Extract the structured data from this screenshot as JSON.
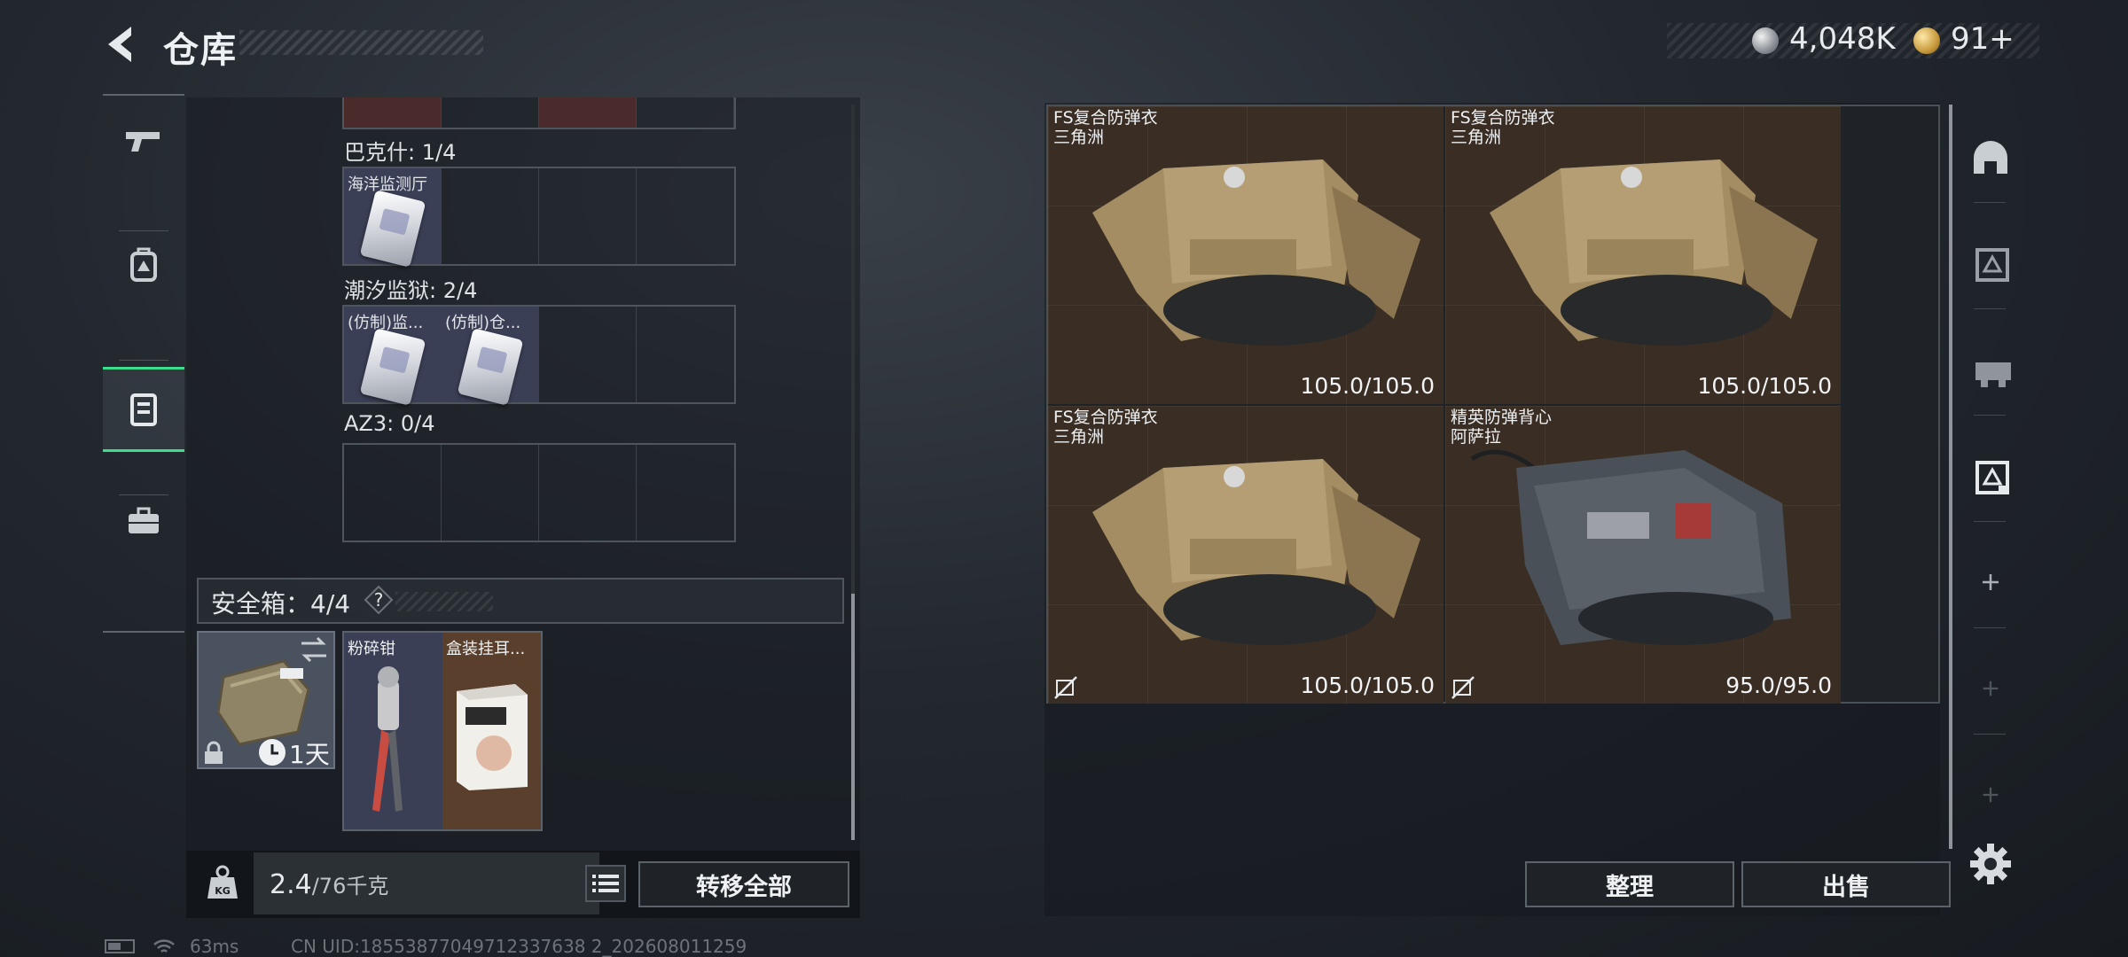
{
  "header": {
    "title": "仓库",
    "currency": {
      "silver": "4,048K",
      "gold": "91+"
    }
  },
  "storage": {
    "cases": [
      {
        "label": "巴克什: 1/4",
        "items": [
          "海洋监测厅"
        ]
      },
      {
        "label": "潮汐监狱: 2/4",
        "items": [
          "(仿制)监...",
          "(仿制)仓..."
        ]
      },
      {
        "label": "AZ3: 0/4",
        "items": []
      }
    ]
  },
  "safebox": {
    "label": "安全箱：4/4",
    "help": "?",
    "timer": "1天",
    "items": [
      "粉碎钳",
      "盒装挂耳..."
    ]
  },
  "weight": {
    "current": "2.4",
    "capacity": "/76千克"
  },
  "buttons": {
    "transfer_all": "转移全部",
    "sort": "整理",
    "sell": "出售"
  },
  "inventory": [
    {
      "name": "FS复合防弹衣",
      "map": "三角洲",
      "durability": "105.0/105.0"
    },
    {
      "name": "FS复合防弹衣",
      "map": "三角洲",
      "durability": "105.0/105.0"
    },
    {
      "name": "FS复合防弹衣",
      "map": "三角洲",
      "durability": "105.0/105.0"
    },
    {
      "name": "精英防弹背心",
      "map": "阿萨拉",
      "durability": "95.0/95.0"
    }
  ],
  "status": {
    "ping": "63ms",
    "uid": "CN UID:18553877049712337638 2_202608011259"
  },
  "colors": {
    "accent_green": "#3ddc8f",
    "vest_bg": "#3a2e24",
    "item_bg": "#3b3f55"
  }
}
